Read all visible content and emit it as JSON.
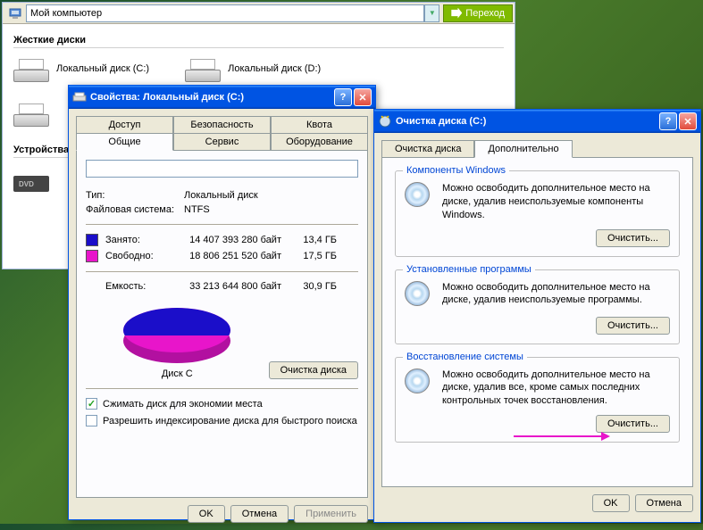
{
  "explorer": {
    "address": "Мой компьютер",
    "go": "Переход",
    "section_hdd": "Жесткие диски",
    "section_removable": "Устройства",
    "drive_c": "Локальный диск (C:)",
    "drive_d": "Локальный диск (D:)",
    "dvd_label": "DVD"
  },
  "props": {
    "title": "Свойства: Локальный диск (C:)",
    "tabs_row1": [
      "Доступ",
      "Безопасность",
      "Квота"
    ],
    "tabs_row2": [
      "Общие",
      "Сервис",
      "Оборудование"
    ],
    "type_label": "Тип:",
    "type_value": "Локальный диск",
    "fs_label": "Файловая система:",
    "fs_value": "NTFS",
    "used_label": "Занято:",
    "used_bytes": "14 407 393 280 байт",
    "used_gb": "13,4 ГБ",
    "free_label": "Свободно:",
    "free_bytes": "18 806 251 520 байт",
    "free_gb": "17,5 ГБ",
    "capacity_label": "Емкость:",
    "capacity_bytes": "33 213 644 800 байт",
    "capacity_gb": "30,9 ГБ",
    "pie_caption": "Диск C",
    "cleanup_btn": "Очистка диска",
    "compress_cb": "Сжимать диск для экономии места",
    "index_cb": "Разрешить индексирование диска для быстрого поиска",
    "ok": "OK",
    "cancel": "Отмена",
    "apply": "Применить"
  },
  "cleanup": {
    "title": "Очистка диска  (C:)",
    "tab_main": "Очистка диска",
    "tab_more": "Дополнительно",
    "group1_title": "Компоненты Windows",
    "group1_text": "Можно освободить дополнительное место на диске, удалив неиспользуемые компоненты Windows.",
    "group2_title": "Установленные программы",
    "group2_text": "Можно освободить дополнительное место на диске, удалив неиспользуемые программы.",
    "group3_title": "Восстановление системы",
    "group3_text": "Можно освободить дополнительное место на диске, удалив все, кроме самых последних контрольных точек восстановления.",
    "clean_btn": "Очистить...",
    "ok": "OK",
    "cancel": "Отмена"
  },
  "chart_data": {
    "type": "pie",
    "title": "Диск C",
    "series": [
      {
        "name": "Занято",
        "value": 14407393280,
        "value_gb": 13.4,
        "color": "#1b0ec9"
      },
      {
        "name": "Свободно",
        "value": 18806251520,
        "value_gb": 17.5,
        "color": "#e815ca"
      }
    ],
    "total": 33213644800,
    "total_gb": 30.9
  }
}
